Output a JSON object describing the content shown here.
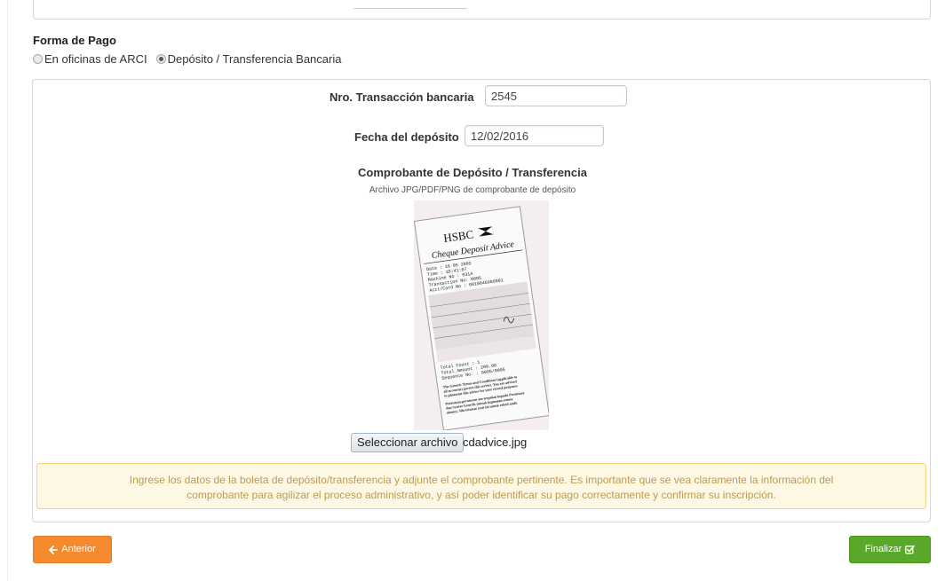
{
  "payment": {
    "label": "Forma de Pago",
    "options": [
      {
        "label": "En oficinas de ARCI",
        "selected": false
      },
      {
        "label": "Depósito / Transferencia Bancaria",
        "selected": true
      }
    ]
  },
  "form": {
    "transaction_label": "Nro. Transacción bancaria",
    "transaction_value": "2545",
    "date_label": "Fecha del depósito",
    "date_value": "12/02/2016"
  },
  "receipt": {
    "title": "Comprobante de Depósito / Transferencia",
    "subtitle": "Archivo JPG/PDF/PNG de comprobante de depósito",
    "image": {
      "bank": "HSBC",
      "heading": "Cheque Deposit Advice",
      "lines": [
        "Date          : 16 05 2002",
        "Time          : 15:41:07",
        "Machine No    : 031A",
        "Transaction No: 0005",
        "Acct/Card No  : 0010046986001"
      ],
      "totals": [
        "Total Count   : 1",
        "Total Amount  : 200.00",
        "Sequence No.  : 0005/0005"
      ],
      "terms": [
        "The Generic Terms and Conditions (applicable to",
        "all accounts) govern this service. You are advised",
        "to photostat this advice for your record purposes.",
        "Peraturan-peraturan am terpakai kepada Perantara",
        "dan Syarat Generik (untuk kegunaan semua",
        "akaun). Sila fotostat resit ini untuk rekod anda."
      ]
    },
    "select_button": "Seleccionar archivo",
    "file_name": "cdadvice.jpg"
  },
  "alert": {
    "line1": "Ingrese los datos de la boleta de depósito/transferencia y adjunte el comprobante pertinente. Es importante que se vea claramente la información del",
    "line2": "comprobante para agilizar el proceso administrativo, y así poder identificar su pago correctamente y confirmar su inscripción."
  },
  "nav": {
    "prev_label": "Anterior",
    "finish_label": "Finalizar"
  },
  "colors": {
    "prev_button": "#f5892d",
    "finish_button": "#5aa82a",
    "alert_bg": "#fcf8e3",
    "alert_text": "#c09853"
  },
  "icons": {
    "prev": "arrow-left-icon",
    "finish": "check-square-icon"
  }
}
